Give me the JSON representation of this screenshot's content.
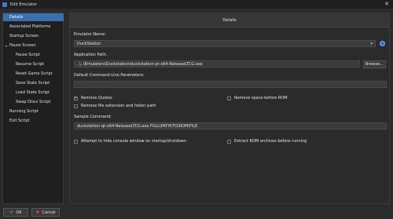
{
  "window": {
    "title": "Edit Emulator",
    "close_glyph": "✕"
  },
  "sidebar": {
    "items": [
      {
        "label": "Details",
        "selected": true
      },
      {
        "label": "Associated Platforms"
      },
      {
        "label": "Startup Screen"
      },
      {
        "label": "Pause Screen",
        "expanded": true
      },
      {
        "label": "Pause Script"
      },
      {
        "label": "Resume Script"
      },
      {
        "label": "Reset Game Script"
      },
      {
        "label": "Save State Script"
      },
      {
        "label": "Load State Script"
      },
      {
        "label": "Swap Discs Script"
      },
      {
        "label": "Running Script"
      },
      {
        "label": "Exit Script"
      }
    ]
  },
  "tabs": {
    "active": "Details"
  },
  "form": {
    "emulator_name_label": "Emulator Name:",
    "emulator_name_value": "DuckStation",
    "application_path_label": "Application Path:",
    "application_path_value": "..\\..\\Emulators\\Duckstation\\duckstation-qt-x64-ReleaseLTCG.exe",
    "browse_label": "Browse...",
    "cmdline_label": "Default Command-Line Parameters:",
    "cmdline_value": "",
    "remove_quotes_label": "Remove Quotes",
    "remove_quotes_checked": true,
    "remove_space_label": "Remove space before ROM",
    "remove_space_checked": false,
    "remove_ext_label": "Remove file extension and folder path",
    "remove_ext_checked": false,
    "sample_command_label": "Sample Command:",
    "sample_command_value": "duckstation-qt-x64-ReleaseLTCG.exe FULL\\PATH\\TO\\ROM\\FILE",
    "hide_console_label": "Attempt to hide console window on startup/shutdown",
    "hide_console_checked": false,
    "extract_rom_label": "Extract ROM archives before running",
    "extract_rom_checked": false
  },
  "footer": {
    "ok_label": "OK",
    "cancel_label": "Cancel"
  },
  "icons": {
    "chevron": "▾",
    "check": "✓",
    "ok": "✔",
    "cancel": "✖",
    "globe": "globe-icon"
  },
  "colors": {
    "selection": "#3a6fb0",
    "ok_icon": "#47c647",
    "cancel_icon": "#e04040"
  }
}
